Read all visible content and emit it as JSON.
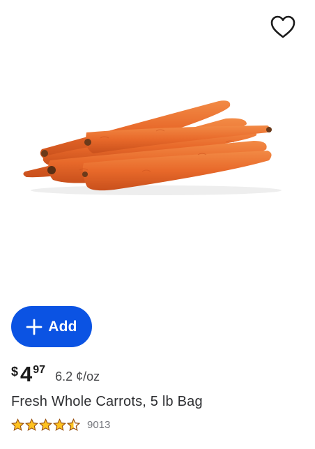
{
  "favorite": {
    "icon": "heart-outline-icon",
    "selected": false
  },
  "product": {
    "image_icon": "carrots-product-image",
    "title": "Fresh Whole Carrots, 5 lb Bag"
  },
  "add_button": {
    "icon": "plus-icon",
    "label": "Add",
    "color": "#0b53e3"
  },
  "price": {
    "currency": "$",
    "dollars": "4",
    "cents": "97",
    "unit_price": "6.2 ¢/oz"
  },
  "rating": {
    "stars": 4.5,
    "max_stars": 5,
    "count": "9013",
    "star_color": "#ffc220",
    "star_outline": "#995213"
  }
}
